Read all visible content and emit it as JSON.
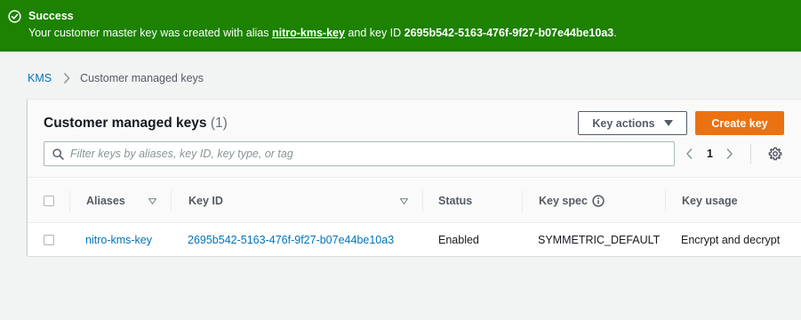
{
  "flash": {
    "type": "success",
    "title": "Success",
    "message_prefix": "Your customer master key was created with alias ",
    "alias": "nitro-kms-key",
    "message_middle": " and key ID ",
    "key_id": "2695b542-5163-476f-9f27-b07e44be10a3",
    "message_suffix": ".",
    "color": "#1d8102",
    "icon": "check-circle-icon"
  },
  "breadcrumb": {
    "items": [
      {
        "label": "KMS"
      },
      {
        "label": "Customer managed keys"
      }
    ],
    "separator_icon": "chevron-right-icon"
  },
  "panel": {
    "title": "Customer managed keys",
    "count": "(1)",
    "actions_button": "Key actions",
    "create_button": "Create key",
    "filter_placeholder": "Filter keys by aliases, key ID, key type, or tag",
    "filter_value": "",
    "pagination": {
      "current_page": "1"
    },
    "accent_color": "#ec7211"
  },
  "table": {
    "columns": [
      {
        "label": "Aliases",
        "sortable": true
      },
      {
        "label": "Key ID",
        "sortable": true
      },
      {
        "label": "Status",
        "sortable": false
      },
      {
        "label": "Key spec",
        "sortable": false,
        "info_icon": "info-icon"
      },
      {
        "label": "Key usage",
        "sortable": false
      }
    ],
    "rows": [
      {
        "alias": "nitro-kms-key",
        "key_id": "2695b542-5163-476f-9f27-b07e44be10a3",
        "status": "Enabled",
        "key_spec": "SYMMETRIC_DEFAULT",
        "key_usage": "Encrypt and decrypt"
      }
    ]
  }
}
